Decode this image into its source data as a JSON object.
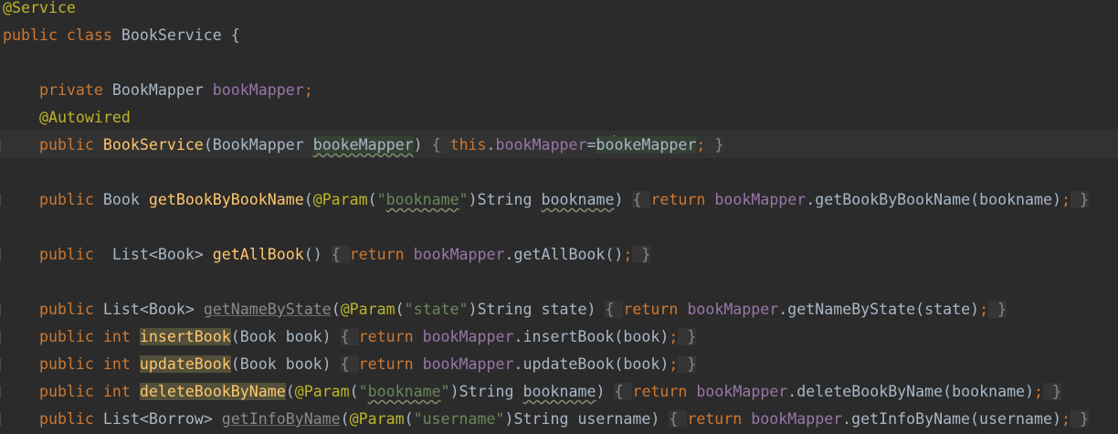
{
  "editor": {
    "language": "java",
    "caret_line": 6,
    "lines": [
      {
        "tokens": [
          {
            "text": "@Service",
            "role": "annotation"
          }
        ]
      },
      {
        "tokens": [
          {
            "text": "public class ",
            "role": "keyword"
          },
          {
            "text": "BookService {",
            "role": "plain"
          }
        ]
      },
      {
        "tokens": []
      },
      {
        "tokens": [
          {
            "text": "    private ",
            "role": "keyword"
          },
          {
            "text": "BookMapper ",
            "role": "plain"
          },
          {
            "text": "bookMapper",
            "role": "field"
          },
          {
            "text": ";",
            "role": "keyword"
          }
        ]
      },
      {
        "tokens": [
          {
            "text": "    @Autowired",
            "role": "annotation"
          }
        ]
      },
      {
        "tokens": [
          {
            "text": "    public ",
            "role": "keyword"
          },
          {
            "text": "BookService",
            "role": "method"
          },
          {
            "text": "(BookMapper ",
            "role": "plain"
          },
          {
            "text": "bookeMapper",
            "role": "param-warn-hl"
          },
          {
            "text": ") ",
            "role": "plain"
          },
          {
            "text": "{ ",
            "role": "fold"
          },
          {
            "text": "this",
            "role": "keyword"
          },
          {
            "text": ".",
            "role": "plain"
          },
          {
            "text": "bookMapper",
            "role": "field"
          },
          {
            "text": "=",
            "role": "plain"
          },
          {
            "text": "bo",
            "role": "plain-hl"
          },
          {
            "text": "",
            "role": "caret"
          },
          {
            "text": "okeMapper",
            "role": "plain-hl"
          },
          {
            "text": ";",
            "role": "keyword"
          },
          {
            "text": " }",
            "role": "fold"
          }
        ]
      },
      {
        "tokens": []
      },
      {
        "tokens": [
          {
            "text": "    public ",
            "role": "keyword"
          },
          {
            "text": "Book ",
            "role": "plain"
          },
          {
            "text": "getBookByBookName",
            "role": "method"
          },
          {
            "text": "(",
            "role": "plain"
          },
          {
            "text": "@Param",
            "role": "annotation"
          },
          {
            "text": "(",
            "role": "plain"
          },
          {
            "text": "\"",
            "role": "string"
          },
          {
            "text": "bookname",
            "role": "string-warn"
          },
          {
            "text": "\"",
            "role": "string"
          },
          {
            "text": ")String ",
            "role": "plain"
          },
          {
            "text": "bookname",
            "role": "param-warn"
          },
          {
            "text": ") ",
            "role": "plain"
          },
          {
            "text": "{ ",
            "role": "fold"
          },
          {
            "text": "return ",
            "role": "keyword"
          },
          {
            "text": "bookMapper",
            "role": "field"
          },
          {
            "text": ".getBookByBookName(bookname)",
            "role": "plain"
          },
          {
            "text": ";",
            "role": "keyword"
          },
          {
            "text": " }",
            "role": "fold"
          }
        ]
      },
      {
        "tokens": []
      },
      {
        "tokens": [
          {
            "text": "    public  ",
            "role": "keyword"
          },
          {
            "text": "List<Book> ",
            "role": "plain"
          },
          {
            "text": "getAllBook",
            "role": "method"
          },
          {
            "text": "() ",
            "role": "plain"
          },
          {
            "text": "{ ",
            "role": "fold"
          },
          {
            "text": "return ",
            "role": "keyword"
          },
          {
            "text": "bookMapper",
            "role": "field"
          },
          {
            "text": ".getAllBook()",
            "role": "plain"
          },
          {
            "text": ";",
            "role": "keyword"
          },
          {
            "text": " }",
            "role": "fold"
          }
        ]
      },
      {
        "tokens": []
      },
      {
        "tokens": [
          {
            "text": "    public ",
            "role": "keyword"
          },
          {
            "text": "List<Book> ",
            "role": "plain"
          },
          {
            "text": "getNameByState",
            "role": "unused"
          },
          {
            "text": "(",
            "role": "plain"
          },
          {
            "text": "@Param",
            "role": "annotation"
          },
          {
            "text": "(",
            "role": "plain"
          },
          {
            "text": "\"state\"",
            "role": "string"
          },
          {
            "text": ")String state) ",
            "role": "plain"
          },
          {
            "text": "{ ",
            "role": "fold"
          },
          {
            "text": "return ",
            "role": "keyword"
          },
          {
            "text": "bookMapper",
            "role": "field"
          },
          {
            "text": ".getNameByState(state)",
            "role": "plain"
          },
          {
            "text": ";",
            "role": "keyword"
          },
          {
            "text": " }",
            "role": "fold"
          }
        ]
      },
      {
        "tokens": [
          {
            "text": "    public int ",
            "role": "keyword"
          },
          {
            "text": "insertBook",
            "role": "method-occ"
          },
          {
            "text": "(Book book) ",
            "role": "plain"
          },
          {
            "text": "{ ",
            "role": "fold"
          },
          {
            "text": "return ",
            "role": "keyword"
          },
          {
            "text": "bookMapper",
            "role": "field"
          },
          {
            "text": ".insertBook(book)",
            "role": "plain"
          },
          {
            "text": ";",
            "role": "keyword"
          },
          {
            "text": " }",
            "role": "fold"
          }
        ]
      },
      {
        "tokens": [
          {
            "text": "    public int ",
            "role": "keyword"
          },
          {
            "text": "updateBook",
            "role": "method-occ"
          },
          {
            "text": "(Book book) ",
            "role": "plain"
          },
          {
            "text": "{ ",
            "role": "fold"
          },
          {
            "text": "return ",
            "role": "keyword"
          },
          {
            "text": "bookMapper",
            "role": "field"
          },
          {
            "text": ".updateBook(book)",
            "role": "plain"
          },
          {
            "text": ";",
            "role": "keyword"
          },
          {
            "text": " }",
            "role": "fold"
          }
        ]
      },
      {
        "tokens": [
          {
            "text": "    public int ",
            "role": "keyword"
          },
          {
            "text": "deleteBookByName",
            "role": "method-occ"
          },
          {
            "text": "(",
            "role": "plain"
          },
          {
            "text": "@Param",
            "role": "annotation"
          },
          {
            "text": "(",
            "role": "plain"
          },
          {
            "text": "\"",
            "role": "string"
          },
          {
            "text": "bookname",
            "role": "string-warn"
          },
          {
            "text": "\"",
            "role": "string"
          },
          {
            "text": ")String ",
            "role": "plain"
          },
          {
            "text": "bookname",
            "role": "param-warn"
          },
          {
            "text": ") ",
            "role": "plain"
          },
          {
            "text": "{ ",
            "role": "fold"
          },
          {
            "text": "return ",
            "role": "keyword"
          },
          {
            "text": "bookMapper",
            "role": "field"
          },
          {
            "text": ".deleteBookByName(bookname)",
            "role": "plain"
          },
          {
            "text": ";",
            "role": "keyword"
          },
          {
            "text": " }",
            "role": "fold"
          }
        ]
      },
      {
        "tokens": [
          {
            "text": "    public ",
            "role": "keyword"
          },
          {
            "text": "List<Borrow> ",
            "role": "plain"
          },
          {
            "text": "getInfoByName",
            "role": "unused"
          },
          {
            "text": "(",
            "role": "plain"
          },
          {
            "text": "@Param",
            "role": "annotation"
          },
          {
            "text": "(",
            "role": "plain"
          },
          {
            "text": "\"username\"",
            "role": "string"
          },
          {
            "text": ")String username) ",
            "role": "plain"
          },
          {
            "text": "{ ",
            "role": "fold"
          },
          {
            "text": "return ",
            "role": "keyword"
          },
          {
            "text": "bookMapper",
            "role": "field"
          },
          {
            "text": ".getInfoByName(username)",
            "role": "plain"
          },
          {
            "text": ";",
            "role": "keyword"
          },
          {
            "text": " }",
            "role": "fold"
          }
        ]
      }
    ]
  }
}
